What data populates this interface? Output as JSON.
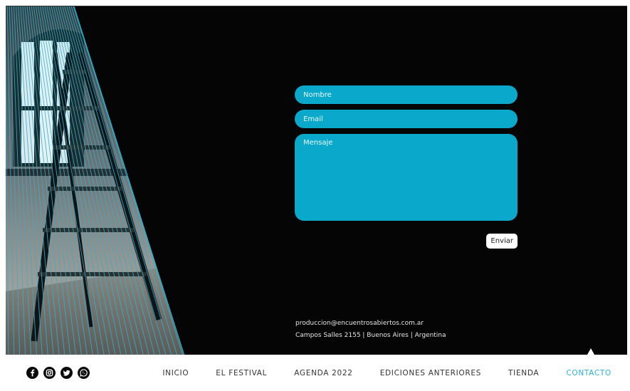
{
  "form": {
    "name_placeholder": "Nombre",
    "email_placeholder": "Email",
    "message_placeholder": "Mensaje",
    "send_label": "Enviar"
  },
  "contact": {
    "email": "produccion@encuentrosabiertos.com.ar",
    "address": "Campos Salles 2155 | Buenos Aires | Argentina"
  },
  "nav": {
    "items": [
      {
        "label": "INICIO"
      },
      {
        "label": "EL FESTIVAL"
      },
      {
        "label": "AGENDA 2022"
      },
      {
        "label": "EDICIONES ANTERIORES"
      },
      {
        "label": "TIENDA"
      },
      {
        "label": "CONTACTO",
        "active": true
      }
    ]
  },
  "social": [
    "facebook-icon",
    "instagram-icon",
    "twitter-icon",
    "whatsapp-icon"
  ],
  "colors": {
    "accent": "#0aa9cb",
    "active_link": "#2bb3d5",
    "background": "#050505"
  }
}
